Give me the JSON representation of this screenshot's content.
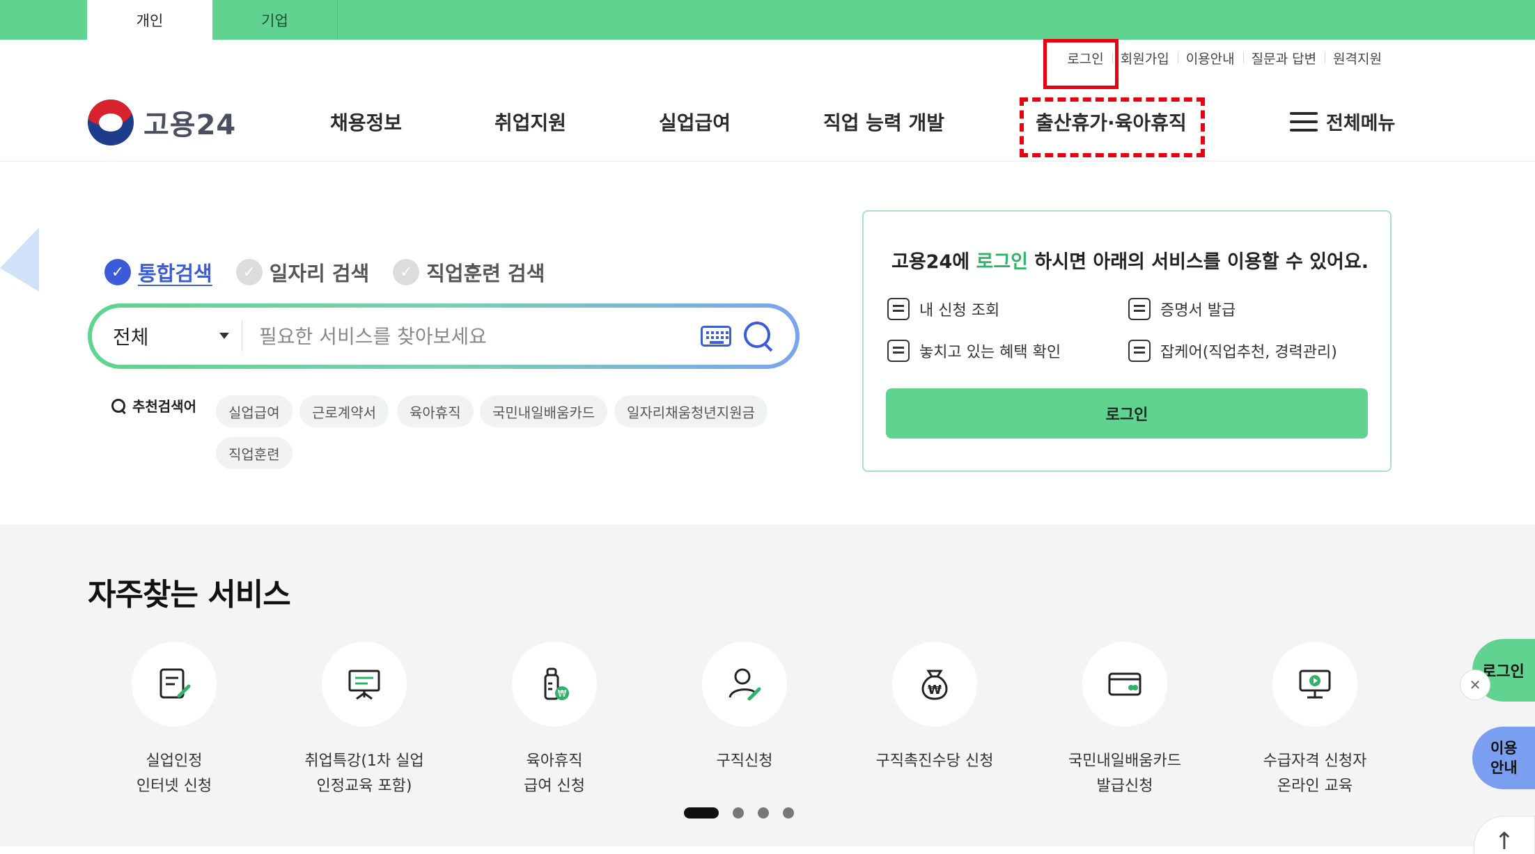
{
  "top_tabs": {
    "personal": "개인",
    "company": "기업"
  },
  "util_links": [
    "로그인",
    "회원가입",
    "이용안내",
    "질문과 답변",
    "원격지원"
  ],
  "logo_text": "고용24",
  "gnb": [
    "채용정보",
    "취업지원",
    "실업급여",
    "직업 능력 개발",
    "출산휴가·육아휴직"
  ],
  "all_menu": "전체메뉴",
  "search": {
    "tabs": [
      "통합검색",
      "일자리 검색",
      "직업훈련 검색"
    ],
    "category": "전체",
    "placeholder": "필요한 서비스를 찾아보세요",
    "reco_label": "추천검색어",
    "keywords": [
      "실업급여",
      "근로계약서",
      "육아휴직",
      "국민내일배움카드",
      "일자리채움청년지원금",
      "직업훈련"
    ]
  },
  "login_panel": {
    "title_pre": "고용24에 ",
    "title_hl": "로그인",
    "title_post": " 하시면 아래의 서비스를 이용할 수 있어요.",
    "items": [
      "내 신청 조회",
      "증명서 발급",
      "놓치고 있는 혜택 확인",
      "잡케어(직업추천, 경력관리)"
    ],
    "button": "로그인"
  },
  "services": {
    "title": "자주찾는 서비스",
    "items": [
      {
        "line1": "실업인정",
        "line2": "인터넷 신청",
        "icon": "document-pen-icon"
      },
      {
        "line1": "취업특강(1차 실업",
        "line2": "인정교육 포함)",
        "icon": "presentation-board-icon"
      },
      {
        "line1": "육아휴직",
        "line2": "급여 신청",
        "icon": "baby-bottle-won-icon"
      },
      {
        "line1": "구직신청",
        "line2": "",
        "icon": "person-pen-icon"
      },
      {
        "line1": "구직촉진수당 신청",
        "line2": "",
        "icon": "money-bag-icon"
      },
      {
        "line1": "국민내일배움카드",
        "line2": "발급신청",
        "icon": "card-icon"
      },
      {
        "line1": "수급자격 신청자",
        "line2": "온라인 교육",
        "icon": "monitor-play-icon"
      }
    ]
  },
  "floating": {
    "login": "로그인",
    "guide_line1": "이용",
    "guide_line2": "안내",
    "close": "✕",
    "top": "↑"
  },
  "colors": {
    "brand_green": "#5fd38f",
    "accent_blue": "#3c5bd8",
    "highlight_red": "#e60012"
  }
}
